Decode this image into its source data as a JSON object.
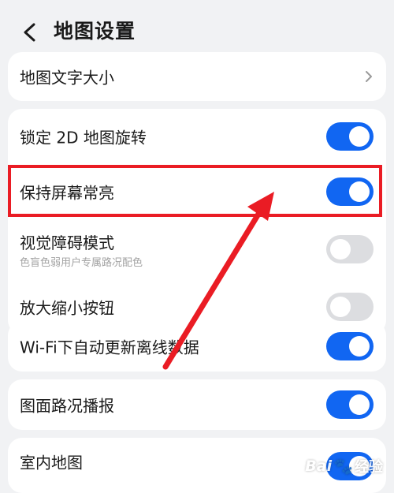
{
  "header": {
    "title": "地图设置",
    "back_icon": "chevron-left-icon"
  },
  "settings": {
    "font_size": {
      "label": "地图文字大小",
      "icon": "chevron-right-icon"
    },
    "lock_2d": {
      "label": "锁定 2D 地图旋转",
      "enabled": true
    },
    "keep_screen_on": {
      "label": "保持屏幕常亮",
      "enabled": true
    },
    "colorblind_mode": {
      "label": "视觉障碍模式",
      "description": "色盲色弱用户专属路况配色",
      "enabled": false
    },
    "zoom_buttons": {
      "label": "放大缩小按钮",
      "enabled": false
    },
    "wifi_offline_update": {
      "label": "Wi-Fi下自动更新离线数据",
      "enabled": true
    },
    "traffic_report": {
      "label": "图面路况播报",
      "enabled": true
    },
    "indoor_map": {
      "label": "室内地图",
      "enabled": true
    }
  },
  "annotation": {
    "color": "#ea1c24"
  },
  "watermark": {
    "text": "Bai",
    "suffix": "经验",
    "icon": "baidu-paw-icon"
  },
  "colors": {
    "accent": "#1166f2",
    "toggle_off": "#dcdde0",
    "background": "#f1f2f4"
  }
}
